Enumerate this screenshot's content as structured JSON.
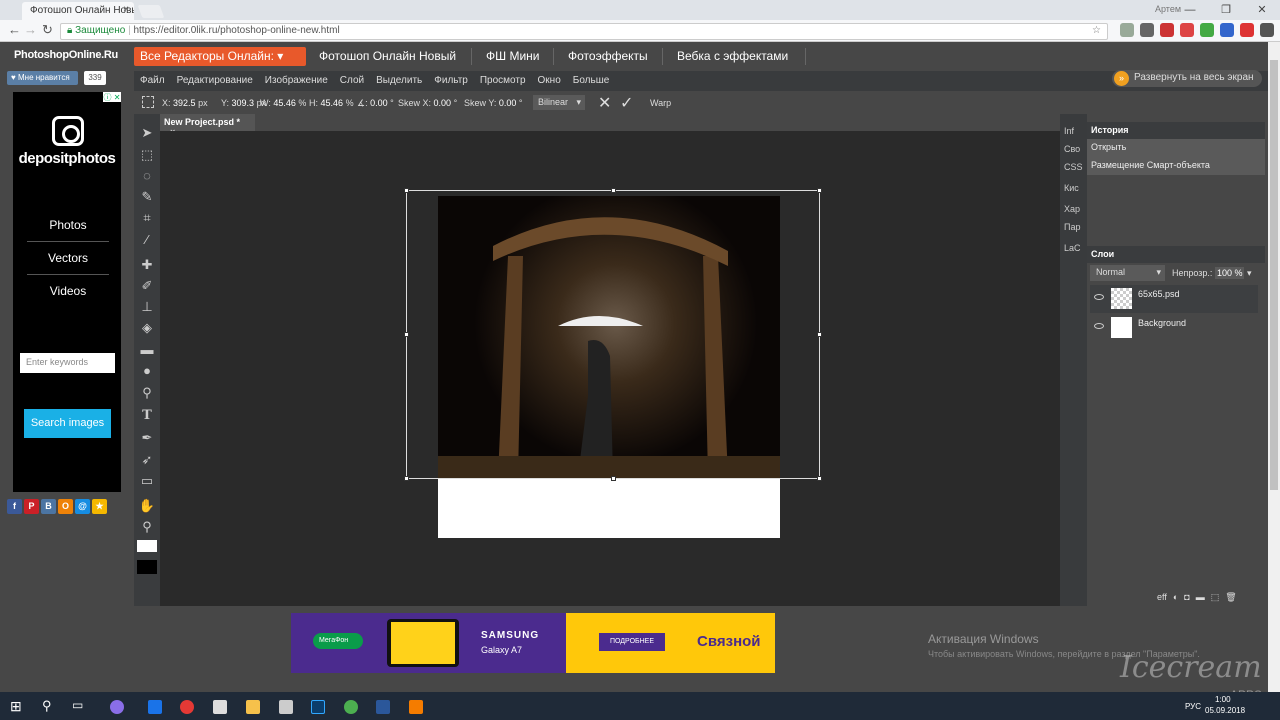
{
  "browser": {
    "tab_title": "Фотошоп Онлайн Новый",
    "tab_close": "×",
    "username": "Артем",
    "secure_label": "Защищено",
    "url": "https://editor.0lik.ru/photoshop-online-new.html",
    "window_controls": [
      "—",
      "❐",
      "✕"
    ]
  },
  "site": {
    "logo": "PhotoshopOnline.Ru",
    "menu_button": "Все Редакторы Онлайн: ▾",
    "nav": [
      "Фотошоп Онлайн Новый",
      "ФШ Мини",
      "Фотоэффекты",
      "Вебка с эффектами"
    ],
    "like_label": "Мне нравится",
    "like_count": "339"
  },
  "ad": {
    "brand": "depositphotos",
    "links": [
      "Photos",
      "Vectors",
      "Videos"
    ],
    "search_placeholder": "Enter keywords",
    "search_button": "Search images",
    "close_label": "ⓘ ✕"
  },
  "social": [
    {
      "label": "f",
      "color": "#3b5998"
    },
    {
      "label": "P",
      "color": "#cb2027"
    },
    {
      "label": "B",
      "color": "#4c75a3"
    },
    {
      "label": "O",
      "color": "#ee8208"
    },
    {
      "label": "@",
      "color": "#168de2"
    },
    {
      "label": "★",
      "color": "#f5b800"
    }
  ],
  "editor": {
    "menu": [
      "Файл",
      "Редактирование",
      "Изображение",
      "Слой",
      "Выделить",
      "Фильтр",
      "Просмотр",
      "Окно",
      "Больше"
    ],
    "expand_button": "Развернуть на весь экран",
    "options": {
      "x_label": "X:",
      "x_value": "392.5",
      "x_unit": "px",
      "y_label": "Y:",
      "y_value": "309.3",
      "y_unit": "px",
      "w_label": "W:",
      "w_value": "45.46",
      "w_unit": "%",
      "h_label": "H:",
      "h_value": "45.46",
      "h_unit": "%",
      "angle_label": "∡:",
      "angle_value": "0.00",
      "angle_unit": "°",
      "skewx_label": "Skew X:",
      "skewx_value": "0.00",
      "skewx_unit": "°",
      "skewy_label": "Skew Y:",
      "skewy_value": "0.00",
      "skewy_unit": "°",
      "interpolation": "Bilinear",
      "cancel": "✕",
      "confirm": "✓",
      "warp": "Warp"
    },
    "doc_tab": "New Project.psd *",
    "doc_tab_close": "×",
    "panel_tabs": [
      "Inf",
      "Сво",
      "CSS",
      "Кис",
      "Хар",
      "Пар",
      "LaC"
    ],
    "history_title": "История",
    "history_items": [
      "Открыть",
      "Размещение Смарт-объекта"
    ],
    "layers_title": "Слои",
    "blend_mode": "Normal",
    "opacity_label": "Непрозр.:",
    "opacity_value": "100 %",
    "layers": [
      "65x65.psd",
      "Background"
    ],
    "layer_tools": [
      "eff",
      "◐",
      "◘",
      "▬",
      "⬚",
      "🗑"
    ]
  },
  "banner": {
    "operator": "МегаФон",
    "product_brand": "SAMSUNG",
    "product_model": "Galaxy A7",
    "cta": "ПОДРОБНЕЕ",
    "store": "Связной"
  },
  "watermark": {
    "activation_title": "Активация Windows",
    "activation_text": "Чтобы активировать Windows, перейдите в раздел \"Параметры\".",
    "icecream": "Icecream",
    "icecream_sub": "APPS"
  },
  "taskbar": {
    "lang": "РУС",
    "time": "1:00",
    "date": "05.09.2018"
  }
}
